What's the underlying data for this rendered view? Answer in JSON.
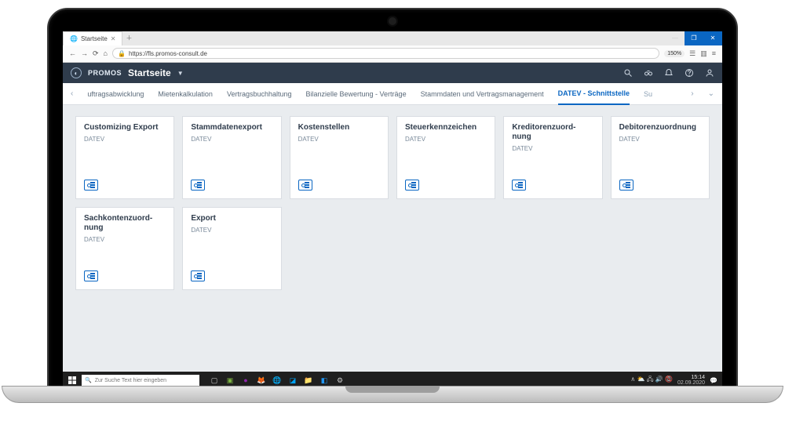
{
  "browser": {
    "tab_title": "Startseite",
    "url_host": "https://fls.promos-consult.de",
    "zoom": "150%"
  },
  "app": {
    "brand": "PROMOS",
    "page_title": "Startseite"
  },
  "tabs": {
    "items": [
      "uftragsabwicklung",
      "Mietenkalkulation",
      "Vertragsbuchhaltung",
      "Bilanzielle Bewertung - Verträge",
      "Stammdaten und Vertragsmanagement",
      "DATEV - Schnittstelle"
    ],
    "trailing": "Su",
    "active_index": 5
  },
  "cards": [
    {
      "title": "Customizing Export",
      "subtitle": "DATEV"
    },
    {
      "title": "Stammdatenexport",
      "subtitle": "DATEV"
    },
    {
      "title": "Kostenstellen",
      "subtitle": "DATEV"
    },
    {
      "title": "Steuerkennzeichen",
      "subtitle": "DATEV"
    },
    {
      "title": "Kreditorenzuord-\nnung",
      "subtitle": "DATEV"
    },
    {
      "title": "Debitorenzuordnung",
      "subtitle": "DATEV"
    },
    {
      "title": "Sachkontenzuord-\nnung",
      "subtitle": "DATEV"
    },
    {
      "title": "Export",
      "subtitle": "DATEV"
    }
  ],
  "taskbar": {
    "search_placeholder": "Zur Suche Text hier eingeben",
    "tray_text": "∧ ⛅ 🖧 🔊 📵",
    "time": "15:14",
    "date": "02.09.2020"
  }
}
